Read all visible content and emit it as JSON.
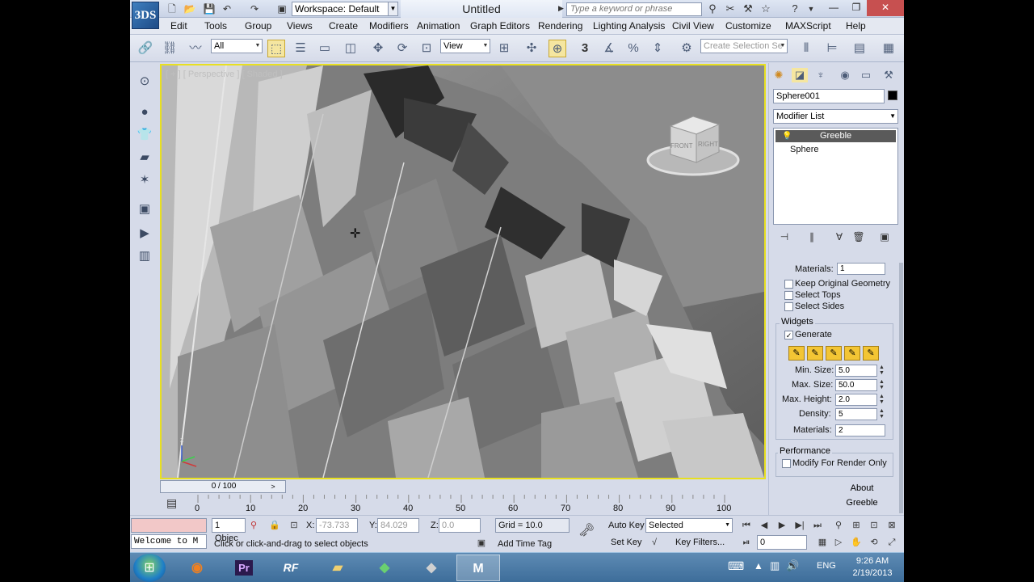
{
  "titlebar": {
    "app_logo": "3DS",
    "workspace": "Workspace: Default",
    "title": "Untitled",
    "search_placeholder": "Type a keyword or phrase"
  },
  "menu": [
    "Edit",
    "Tools",
    "Group",
    "Views",
    "Create",
    "Modifiers",
    "Animation",
    "Graph Editors",
    "Rendering",
    "Lighting Analysis",
    "Civil View",
    "Customize",
    "MAXScript",
    "Help"
  ],
  "toolbar": {
    "selection_filter": "All",
    "ref_coord": "View",
    "named_selection_placeholder": "Create Selection Se",
    "snap_label": "3"
  },
  "viewport": {
    "label": "[ + ] [ Perspective ] [ Shaded ]",
    "viewcube_front": "FRONT",
    "viewcube_right": "RIGHT",
    "axis_z": "z"
  },
  "command_panel": {
    "object_name": "Sphere001",
    "modifier_list": "Modifier List",
    "stack": [
      "Greeble",
      "Sphere"
    ],
    "params": {
      "materials_top_label": "Materials:",
      "materials_top_value": "1",
      "keep_original_geometry": "Keep Original Geometry",
      "select_tops": "Select Tops",
      "select_sides": "Select Sides",
      "widgets_group": "Widgets",
      "generate": "Generate",
      "min_size_label": "Min. Size:",
      "min_size": "5.0",
      "max_size_label": "Max. Size:",
      "max_size": "50.0",
      "max_height_label": "Max. Height:",
      "max_height": "2.0",
      "density_label": "Density:",
      "density": "5",
      "materials_label": "Materials:",
      "materials": "2",
      "performance_group": "Performance",
      "modify_for_render_only": "Modify For Render Only",
      "about": "About Greeble"
    }
  },
  "timeline": {
    "slider": "0 / 100",
    "ticks": [
      "0",
      "10",
      "20",
      "30",
      "40",
      "50",
      "60",
      "70",
      "80",
      "90",
      "100"
    ]
  },
  "status": {
    "selection": "1 Objec",
    "x_label": "X:",
    "x_value": "-73.733",
    "y_label": "Y:",
    "y_value": "84.029",
    "z_label": "Z:",
    "z_value": "0.0",
    "grid": "Grid = 10.0",
    "prompt": "Click or click-and-drag to select objects",
    "add_time_tag": "Add Time Tag",
    "auto_key": "Auto Key",
    "set_key": "Set Key",
    "key_mode": "Selected",
    "key_filters": "Key Filters...",
    "frame": "0",
    "maxscript_welcome": "Welcome to M"
  },
  "taskbar": {
    "apps": [
      "Firefox",
      "Pr",
      "RF",
      "Explorer",
      "App",
      "App2",
      "3ds Max"
    ],
    "lang": "ENG",
    "time": "9:26 AM",
    "date": "2/19/2013"
  }
}
